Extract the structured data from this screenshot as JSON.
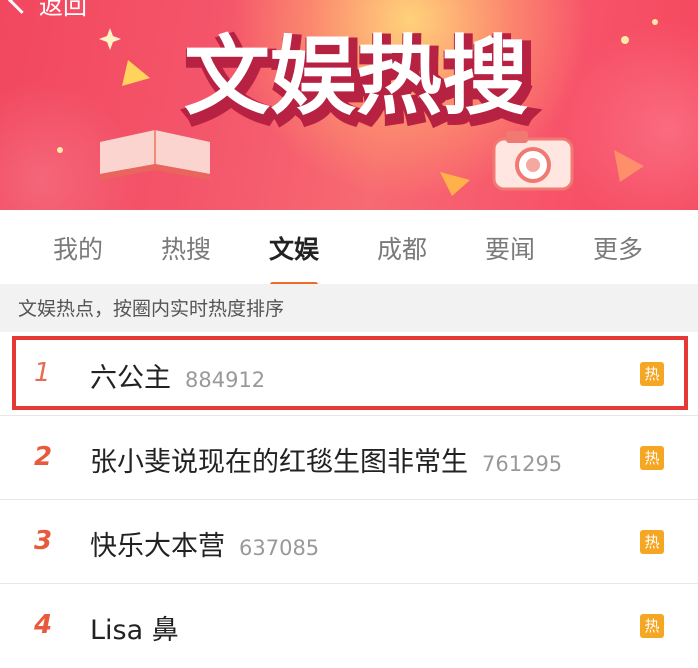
{
  "header": {
    "back_label": "返回",
    "banner_title": "文娱热搜"
  },
  "tabs": [
    {
      "label": "我的",
      "active": false
    },
    {
      "label": "热搜",
      "active": false
    },
    {
      "label": "文娱",
      "active": true
    },
    {
      "label": "成都",
      "active": false
    },
    {
      "label": "要闻",
      "active": false
    },
    {
      "label": "更多",
      "active": false
    }
  ],
  "subhead": "文娱热点，按圈内实时热度排序",
  "list": [
    {
      "rank": "1",
      "term": "六公主",
      "count": "884912",
      "badge": "热"
    },
    {
      "rank": "2",
      "term": "张小斐说现在的红毯生图非常生",
      "count": "761295",
      "badge": "热"
    },
    {
      "rank": "3",
      "term": "快乐大本营",
      "count": "637085",
      "badge": "热"
    },
    {
      "rank": "4",
      "term": "Lisa 鼻",
      "count": "",
      "badge": "热"
    }
  ],
  "colors": {
    "accent": "#f26a2a",
    "banner": "#f2475f",
    "badge": "#f5a623",
    "highlight": "#e53935"
  }
}
